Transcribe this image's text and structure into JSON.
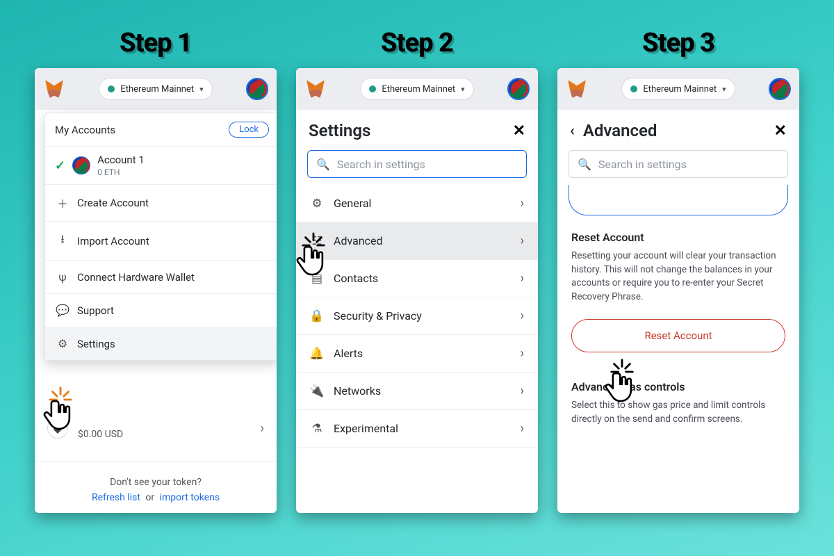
{
  "steps": {
    "s1": "Step 1",
    "s2": "Step 2",
    "s3": "Step 3"
  },
  "header": {
    "network": "Ethereum Mainnet"
  },
  "accountsMenu": {
    "title": "My Accounts",
    "lock": "Lock",
    "account": {
      "name": "Account 1",
      "balance": "0 ETH"
    },
    "items": {
      "create": "Create Account",
      "import": "Import Account",
      "hw": "Connect Hardware Wallet",
      "support": "Support",
      "settings": "Settings"
    }
  },
  "assets": {
    "usd": "$0.00 USD",
    "hint": "Don't see your token?",
    "refresh": "Refresh list",
    "or": "or",
    "import": "import tokens"
  },
  "settingsPage": {
    "title": "Settings",
    "searchPlaceholder": "Search in settings",
    "rows": {
      "general": "General",
      "advanced": "Advanced",
      "contacts": "Contacts",
      "security": "Security & Privacy",
      "alerts": "Alerts",
      "networks": "Networks",
      "experimental": "Experimental"
    }
  },
  "advancedPage": {
    "title": "Advanced",
    "searchPlaceholder": "Search in settings",
    "reset": {
      "heading": "Reset Account",
      "body": "Resetting your account will clear your transaction history. This will not change the balances in your accounts or require you to re-enter your Secret Recovery Phrase.",
      "button": "Reset Account"
    },
    "gas": {
      "heading": "Advanced gas controls",
      "body": "Select this to show gas price and limit controls directly on the send and confirm screens."
    }
  }
}
